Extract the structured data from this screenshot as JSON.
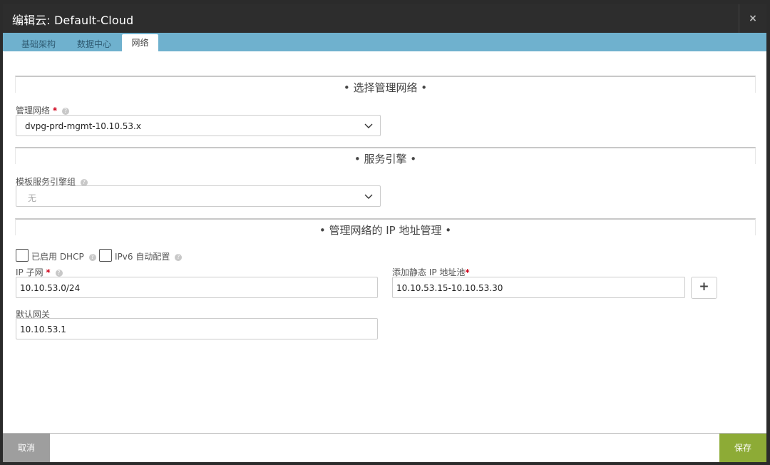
{
  "modal": {
    "title": "编辑云: Default-Cloud",
    "close_label": "×"
  },
  "tabs": [
    {
      "label": "基础架构",
      "active": false
    },
    {
      "label": "数据中心",
      "active": false
    },
    {
      "label": "网络",
      "active": true
    }
  ],
  "sections": {
    "mgmt_network": "• 选择管理网络 •",
    "service_engine": "• 服务引擎 •",
    "ip_management": "• 管理网络的 IP 地址管理 •"
  },
  "mgmt_network": {
    "label": "管理网络",
    "required": "*",
    "value": "dvpg-prd-mgmt-10.10.53.x"
  },
  "se_group": {
    "label": "模板服务引擎组",
    "value": "无"
  },
  "dhcp": {
    "label": "已启用 DHCP",
    "checked": false
  },
  "ipv6": {
    "label": "IPv6 自动配置",
    "checked": false
  },
  "ip_subnet": {
    "label": "IP 子网",
    "required": "*",
    "value": "10.10.53.0/24"
  },
  "static_pool": {
    "label": "添加静态 IP 地址池",
    "required": "*",
    "value": "10.10.53.15-10.10.53.30",
    "add_label": "+"
  },
  "default_gateway": {
    "label": "默认网关",
    "value": "10.10.53.1"
  },
  "footer": {
    "cancel_label": "取消",
    "save_label": "保存"
  },
  "colors": {
    "tabbar": "#6fb1ce",
    "save": "#8dab36",
    "cancel": "#9e9e9e",
    "titlebar": "#2d2d2d",
    "required": "#d0021b"
  },
  "icons": {
    "help": "question-circle-icon",
    "dropdown": "chevron-down-icon",
    "add": "plus-icon",
    "close": "close-icon"
  }
}
